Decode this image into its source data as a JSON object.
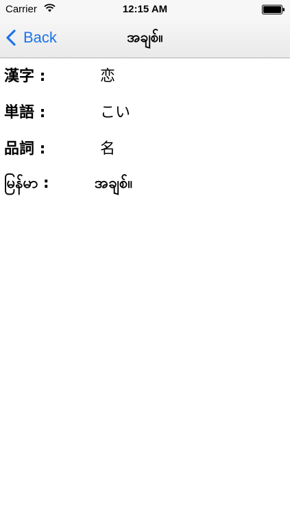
{
  "status_bar": {
    "carrier": "Carrier",
    "time": "12:15 AM",
    "wifi_icon": "wifi-icon",
    "battery_icon": "battery-icon"
  },
  "nav": {
    "back_label": "Back",
    "back_icon": "chevron-left-icon",
    "title": "အချစ်။",
    "accent_color": "#1a73e8"
  },
  "entry": {
    "rows": [
      {
        "label": "漢字 :",
        "value": "恋"
      },
      {
        "label": "単語 :",
        "value": "こい"
      },
      {
        "label": "品詞 :",
        "value": "名"
      },
      {
        "label": "မြန်မာ :",
        "value": "အချစ်။"
      }
    ]
  }
}
